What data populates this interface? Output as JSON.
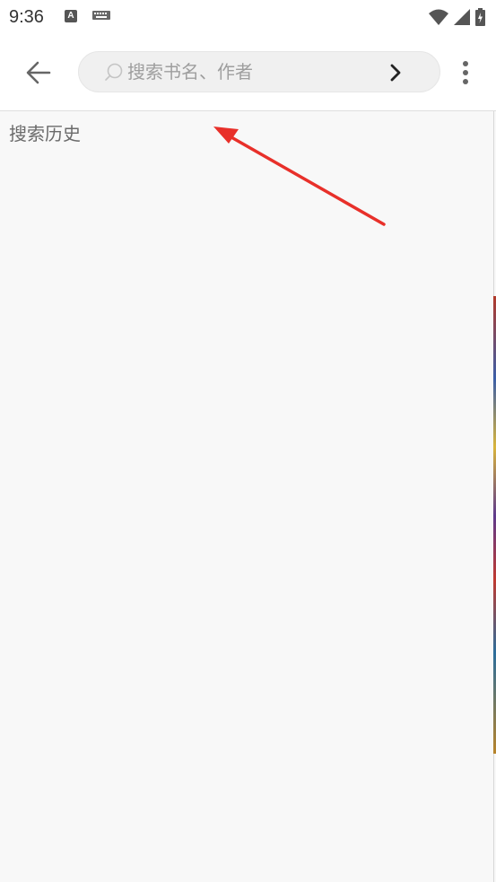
{
  "status_bar": {
    "time": "9:36",
    "notification_letter": "A"
  },
  "toolbar": {
    "search": {
      "placeholder": "搜索书名、作者",
      "value": ""
    }
  },
  "content": {
    "history_label": "搜索历史"
  },
  "icons": {
    "back": "arrow-left-icon",
    "search": "search-icon",
    "submit": "chevron-right-icon",
    "more": "more-vert-icon"
  },
  "colors": {
    "background": "#f8f8f8",
    "toolbar": "#ffffff",
    "search_box": "#f0f0f0",
    "annotation_arrow": "#e8302a"
  }
}
